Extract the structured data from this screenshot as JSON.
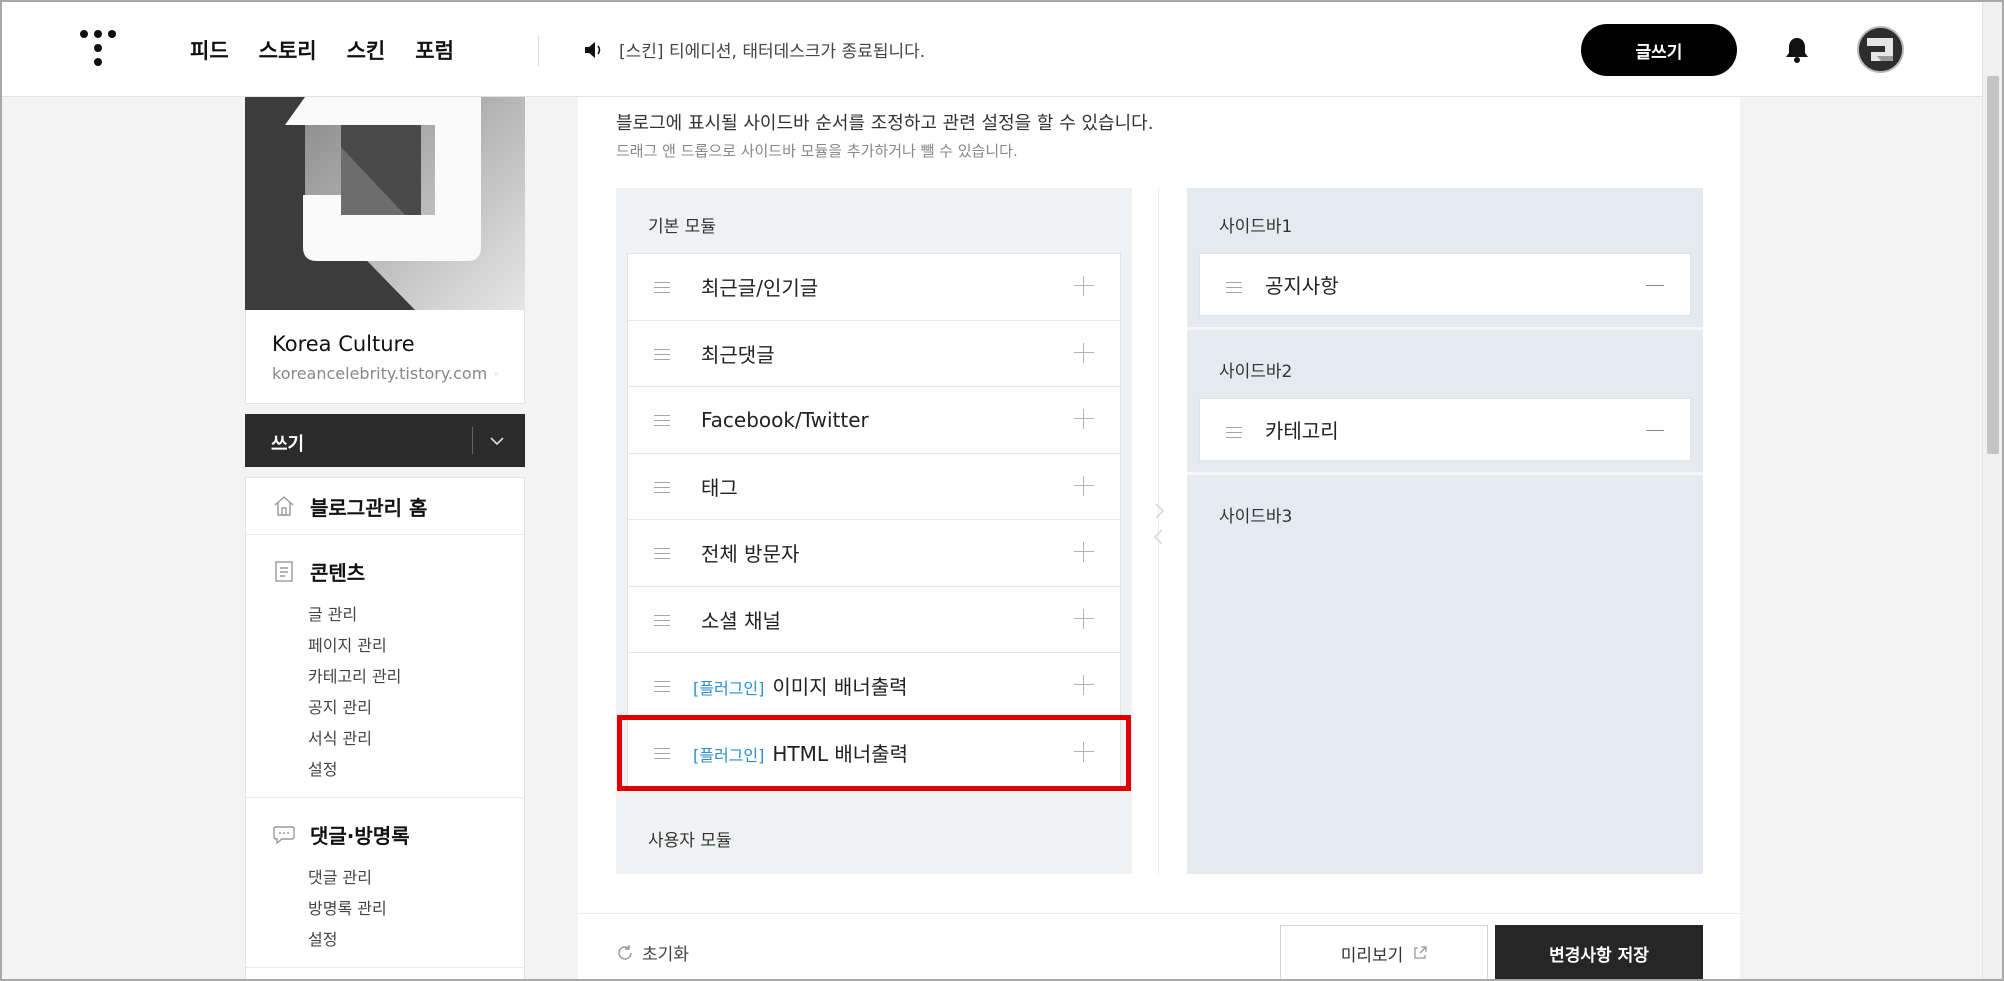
{
  "header": {
    "nav": [
      "피드",
      "스토리",
      "스킨",
      "포럼"
    ],
    "notice": "[스킨] 티에디션, 태터데스크가 종료됩니다.",
    "write_label": "글쓰기"
  },
  "blog": {
    "name": "Korea Culture",
    "url": "koreancelebrity.tistory.com"
  },
  "write_bar": {
    "label": "쓰기"
  },
  "menu": {
    "home": "블로그관리 홈",
    "contents": {
      "title": "콘텐츠",
      "items": [
        "글 관리",
        "페이지 관리",
        "카테고리 관리",
        "공지 관리",
        "서식 관리",
        "설정"
      ]
    },
    "comments": {
      "title": "댓글·방명록",
      "items": [
        "댓글 관리",
        "방명록 관리",
        "설정"
      ]
    }
  },
  "main": {
    "desc1": "블로그에 표시될 사이드바 순서를 조정하고 관련 설정을 할 수 있습니다.",
    "desc2": "드래그 앤 드롭으로 사이드바 모듈을 추가하거나 뺄 수 있습니다.",
    "basic_label": "기본 모듈",
    "user_label": "사용자 모듈",
    "modules": [
      {
        "tag": "",
        "name": "최근글/인기글"
      },
      {
        "tag": "",
        "name": "최근댓글"
      },
      {
        "tag": "",
        "name": "Facebook/Twitter"
      },
      {
        "tag": "",
        "name": "태그"
      },
      {
        "tag": "",
        "name": "전체 방문자"
      },
      {
        "tag": "",
        "name": "소셜 채널"
      },
      {
        "tag": "[플러그인]",
        "name": "이미지 배너출력"
      },
      {
        "tag": "[플러그인]",
        "name": "HTML 배너출력"
      }
    ],
    "sidebars": [
      {
        "label": "사이드바1",
        "items": [
          "공지사항"
        ]
      },
      {
        "label": "사이드바2",
        "items": [
          "카테고리"
        ]
      },
      {
        "label": "사이드바3",
        "items": []
      }
    ],
    "reset_label": "초기화",
    "preview_label": "미리보기",
    "save_label": "변경사항 저장"
  },
  "colors": {
    "highlight": "#e00000",
    "plugin_tag": "#2b8ecf",
    "dark_button": "#262626"
  }
}
